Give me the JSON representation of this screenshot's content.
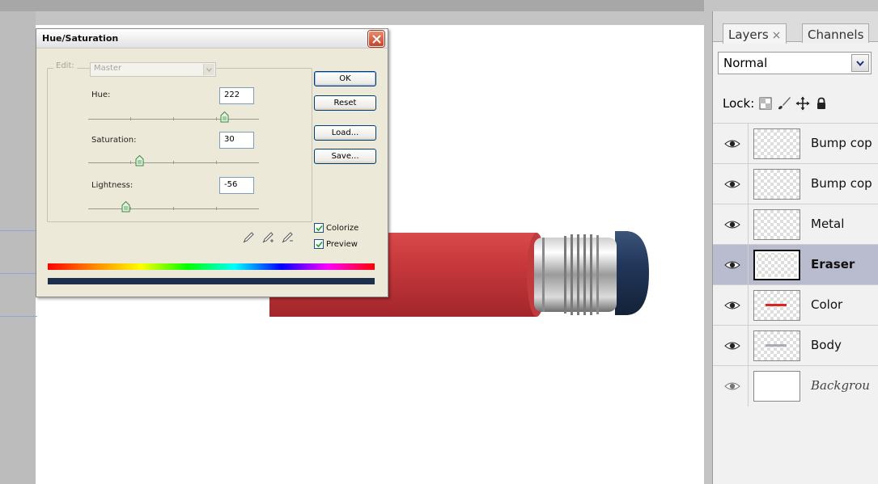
{
  "dialog": {
    "title": "Hue/Saturation",
    "edit_label": "Edit:",
    "edit_value": "Master",
    "hue_label": "Hue:",
    "hue_value": "222",
    "saturation_label": "Saturation:",
    "saturation_value": "30",
    "lightness_label": "Lightness:",
    "lightness_value": "-56",
    "hue_slider_fraction": 0.8,
    "saturation_slider_fraction": 0.3,
    "lightness_slider_fraction": 0.22,
    "ok_label": "OK",
    "reset_label": "Reset",
    "load_label": "Load...",
    "save_label": "Save...",
    "colorize_label": "Colorize",
    "colorize_checked": true,
    "preview_label": "Preview",
    "preview_checked": true
  },
  "layers_panel": {
    "tabs": [
      {
        "label": "Layers"
      },
      {
        "label": "Channels"
      }
    ],
    "blend_mode": "Normal",
    "lock_label": "Lock:",
    "layers": [
      {
        "name": "Bump cop",
        "visible": true,
        "selected": false
      },
      {
        "name": "Bump cop",
        "visible": true,
        "selected": false
      },
      {
        "name": "Metal",
        "visible": true,
        "selected": false
      },
      {
        "name": "Eraser",
        "visible": true,
        "selected": true
      },
      {
        "name": "Color",
        "visible": true,
        "selected": false
      },
      {
        "name": "Body",
        "visible": true,
        "selected": false
      },
      {
        "name": "Backgrou",
        "visible": true,
        "selected": false
      }
    ]
  },
  "colors": {
    "pencil_body": "#c8393c",
    "eraser": "#1f3250",
    "result_bar": "#1d2f4a",
    "accent_xp": "#003c74"
  }
}
